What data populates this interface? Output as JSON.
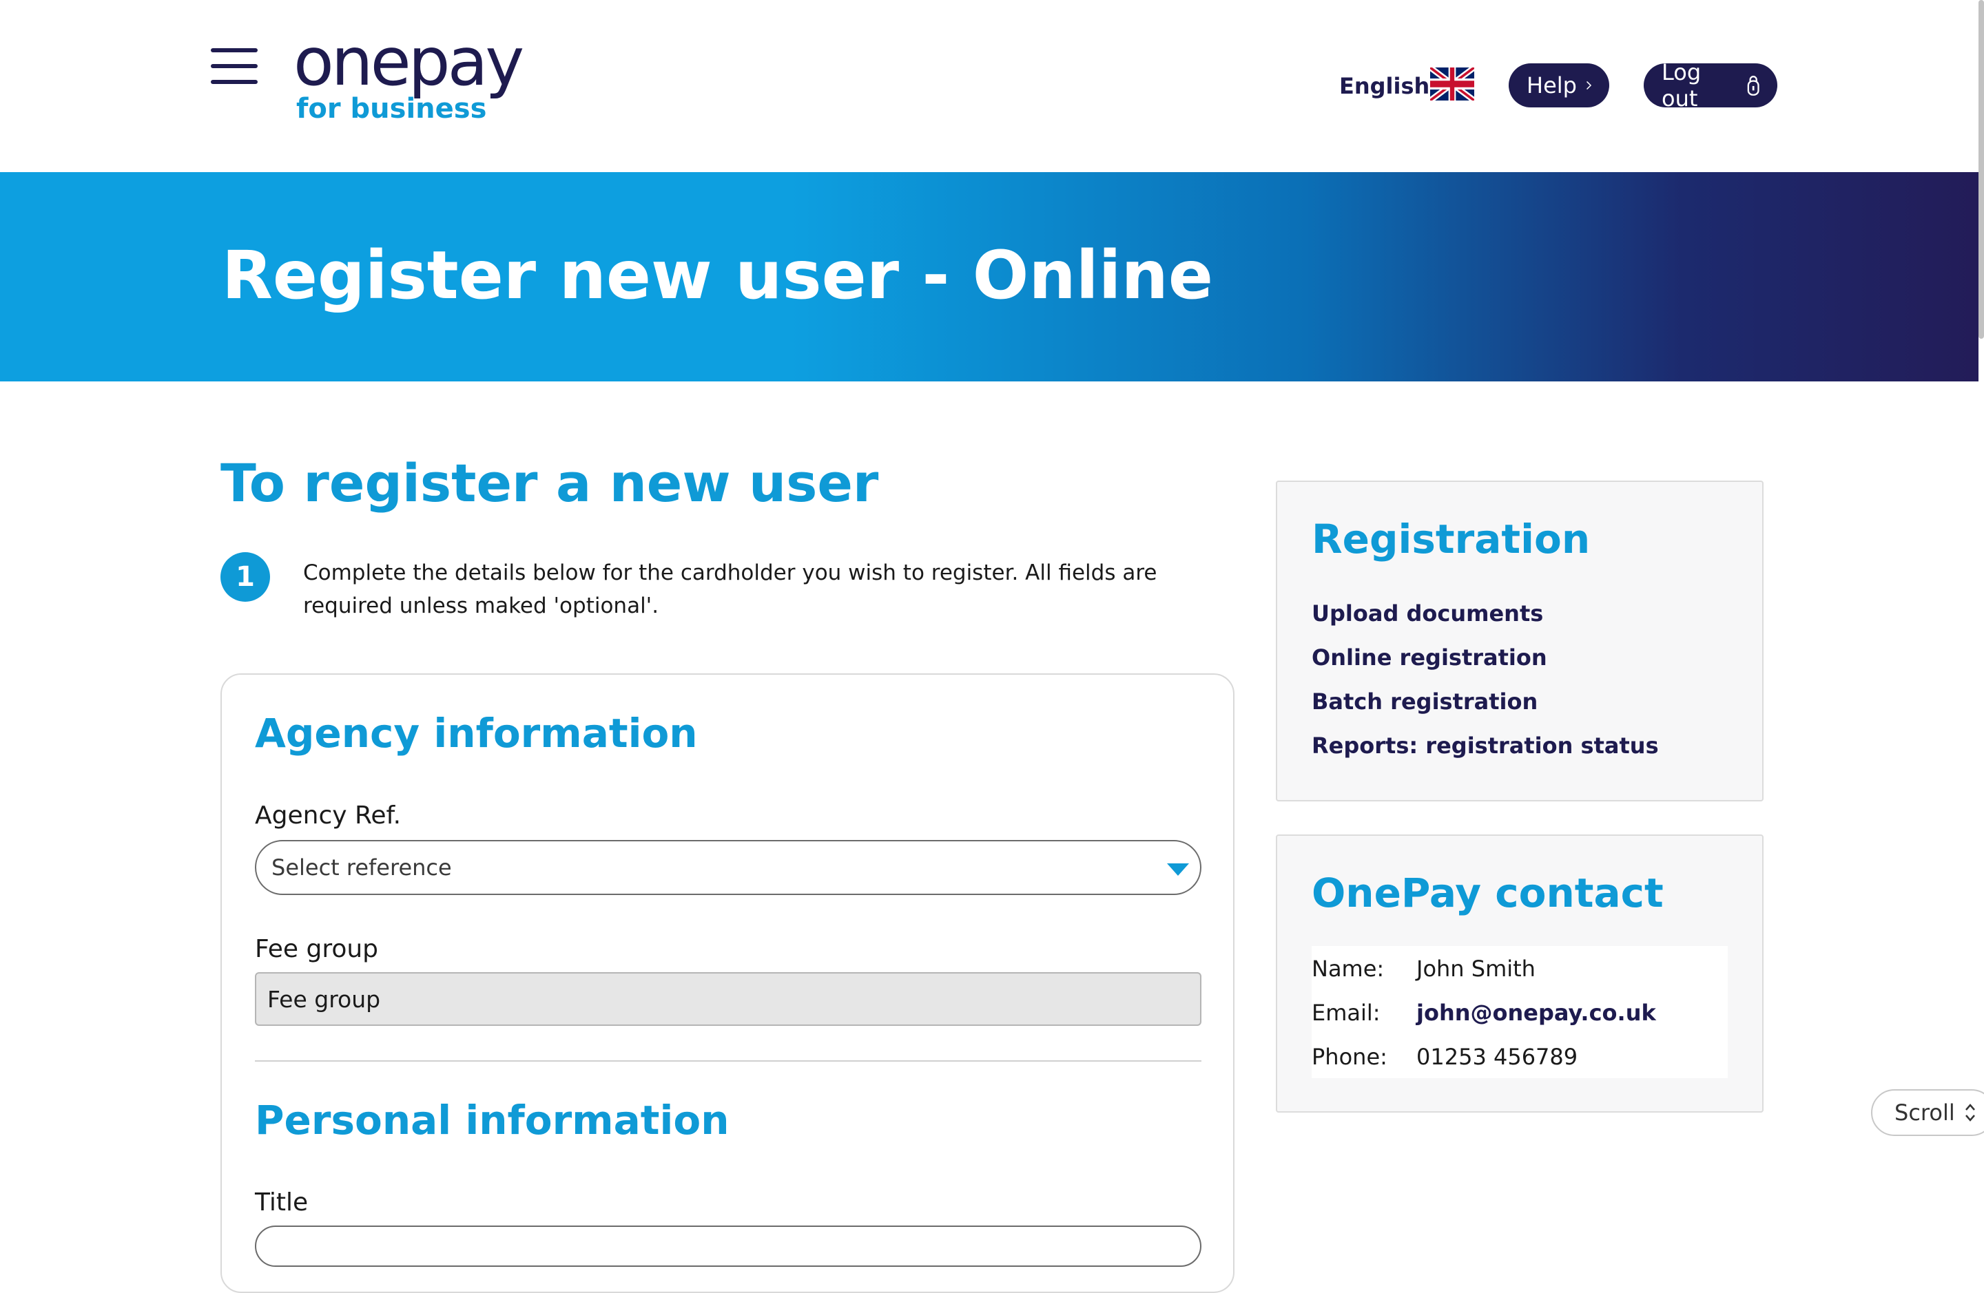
{
  "header": {
    "logo_main": "onepay",
    "logo_sub": "for business",
    "language": "English",
    "help_label": "Help",
    "logout_label": "Log out"
  },
  "banner": {
    "title": "Register new user - Online"
  },
  "main": {
    "section_title": "To register a new user",
    "step_number": "1",
    "step_text": "Complete the details below for the cardholder you wish to register. All fields are required unless maked 'optional'.",
    "agency": {
      "heading": "Agency information",
      "ref_label": "Agency Ref.",
      "ref_placeholder": "Select reference",
      "fee_label": "Fee group",
      "fee_value": "Fee group"
    },
    "personal": {
      "heading": "Personal information",
      "title_label": "Title"
    }
  },
  "sidebar": {
    "registration": {
      "heading": "Registration",
      "links": [
        "Upload documents",
        "Online registration",
        "Batch registration",
        "Reports: registration status"
      ]
    },
    "contact": {
      "heading": "OnePay contact",
      "name_label": "Name:",
      "name_value": "John Smith",
      "email_label": "Email:",
      "email_value": "john@onepay.co.uk",
      "phone_label": "Phone:",
      "phone_value": "01253 456789"
    }
  },
  "scroll_label": "Scroll",
  "colors": {
    "brand_navy": "#1e1b4f",
    "brand_blue": "#0f9ad6"
  }
}
